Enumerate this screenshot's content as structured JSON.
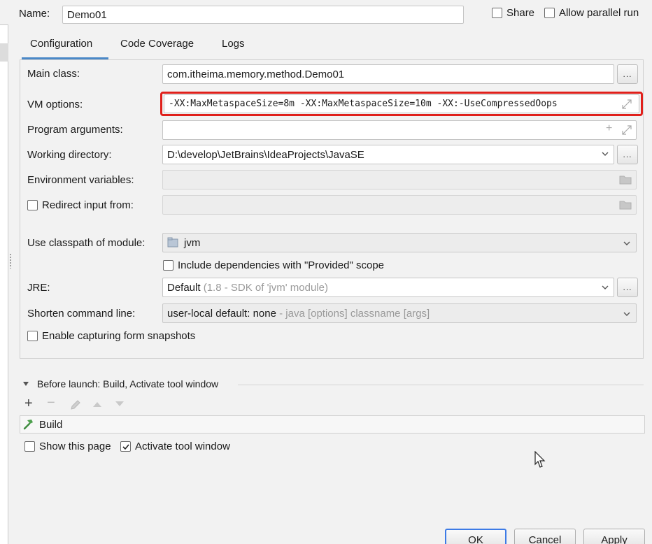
{
  "header": {
    "name_label": "Name:",
    "name_value": "Demo01",
    "share_label": "Share",
    "parallel_label": "Allow parallel run"
  },
  "tabs": [
    {
      "label": "Configuration",
      "active": true
    },
    {
      "label": "Code Coverage",
      "active": false
    },
    {
      "label": "Logs",
      "active": false
    }
  ],
  "config": {
    "main_class_label": "Main class:",
    "main_class_value": "com.itheima.memory.method.Demo01",
    "vm_options_label": "VM options:",
    "vm_options_value": "-XX:MaxMetaspaceSize=8m -XX:MaxMetaspaceSize=10m -XX:-UseCompressedOops",
    "program_args_label": "Program arguments:",
    "program_args_value": "",
    "working_dir_label": "Working directory:",
    "working_dir_value": "D:\\develop\\JetBrains\\IdeaProjects\\JavaSE",
    "env_vars_label": "Environment variables:",
    "env_vars_value": "",
    "redirect_label": "Redirect input from:",
    "redirect_value": "",
    "classpath_label": "Use classpath of module:",
    "classpath_value": "jvm",
    "include_deps_label": "Include dependencies with \"Provided\" scope",
    "jre_label": "JRE:",
    "jre_value": "Default",
    "jre_hint": "(1.8 - SDK of 'jvm' module)",
    "shorten_label": "Shorten command line:",
    "shorten_value": "user-local default: none",
    "shorten_hint": "- java [options] classname [args]",
    "capture_label": "Enable capturing form snapshots",
    "browse_label": "..."
  },
  "before_launch": {
    "title": "Before launch: Build, Activate tool window",
    "items": [
      "Build"
    ],
    "show_page_label": "Show this page",
    "activate_label": "Activate tool window"
  },
  "buttons": {
    "ok": "OK",
    "cancel": "Cancel",
    "apply": "Apply"
  },
  "colors": {
    "highlight": "#e0201b",
    "tab_underline": "#4a88c7",
    "default_button": "#3d7be6"
  }
}
